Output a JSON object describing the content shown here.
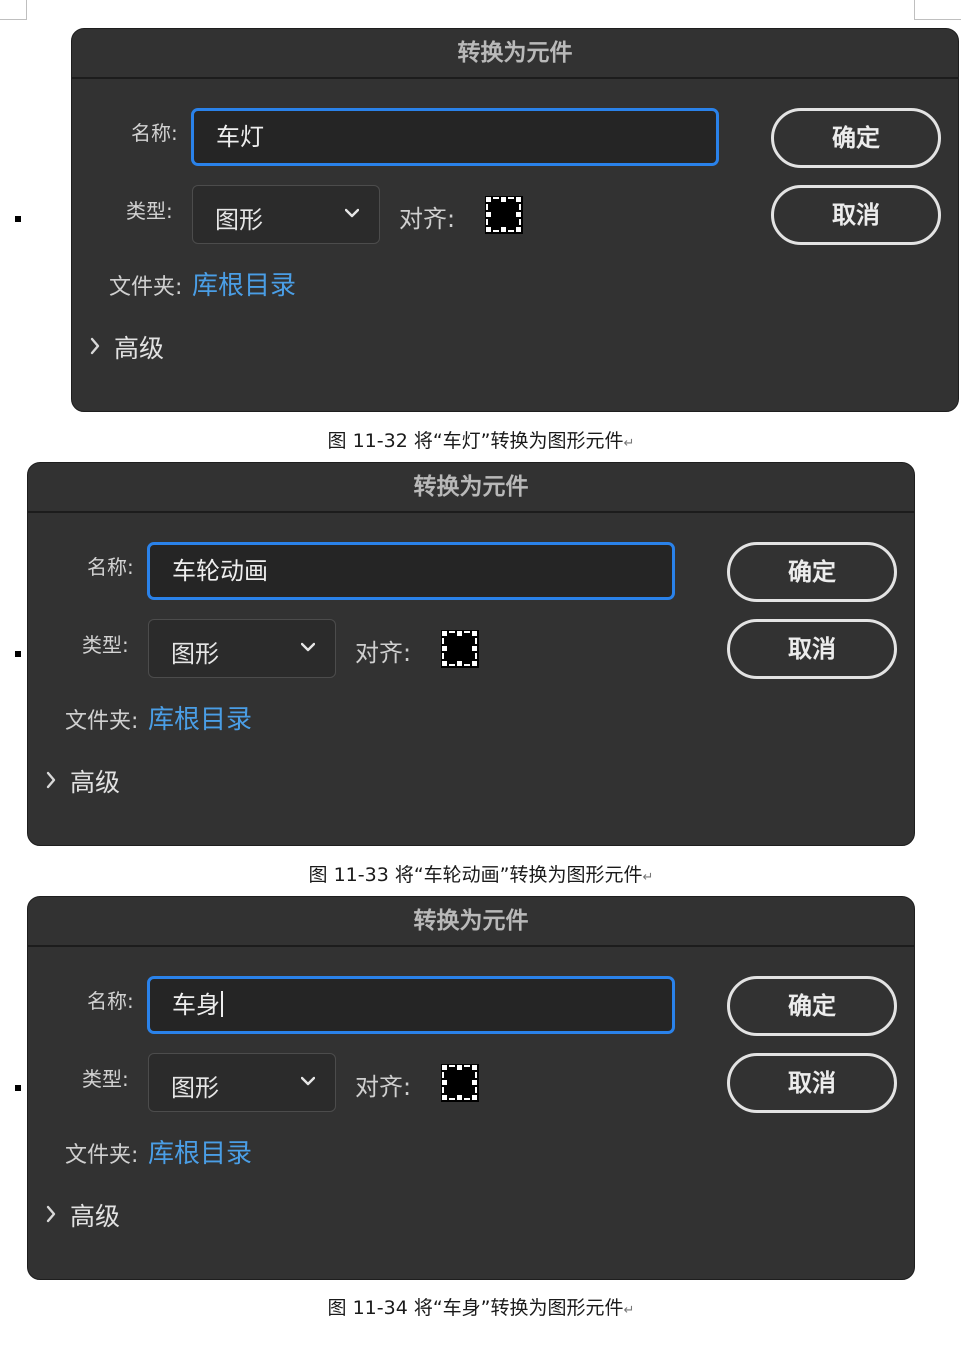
{
  "figures": [
    {
      "dialog": {
        "title": "转换为元件",
        "name_label": "名称:",
        "name_value": "车灯",
        "type_label": "类型:",
        "type_value": "图形",
        "align_label": "对齐:",
        "folder_label": "文件夹:",
        "folder_value": "库根目录",
        "advanced_label": "高级",
        "ok_label": "确定",
        "cancel_label": "取消"
      },
      "caption": "图 11-32 将“车灯”转换为图形元件"
    },
    {
      "dialog": {
        "title": "转换为元件",
        "name_label": "名称:",
        "name_value": "车轮动画",
        "type_label": "类型:",
        "type_value": "图形",
        "align_label": "对齐:",
        "folder_label": "文件夹:",
        "folder_value": "库根目录",
        "advanced_label": "高级",
        "ok_label": "确定",
        "cancel_label": "取消"
      },
      "caption": "图 11-33 将“车轮动画”转换为图形元件"
    },
    {
      "dialog": {
        "title": "转换为元件",
        "name_label": "名称:",
        "name_value": "车身",
        "type_label": "类型:",
        "type_value": "图形",
        "align_label": "对齐:",
        "folder_label": "文件夹:",
        "folder_value": "库根目录",
        "advanced_label": "高级",
        "ok_label": "确定",
        "cancel_label": "取消"
      },
      "caption": "图 11-34 将“车身”转换为图形元件"
    }
  ],
  "colors": {
    "dialog_bg": "#323232",
    "name_border": "#2a82ea",
    "folder_link": "#4a9ee6",
    "button_border": "#e3e3e3"
  },
  "icons": {
    "paragraph_mark": "↵",
    "select_arrow": "chevron-down-icon",
    "advanced_toggle": "chevron-right-icon",
    "alignment": "registration-grid-icon"
  }
}
